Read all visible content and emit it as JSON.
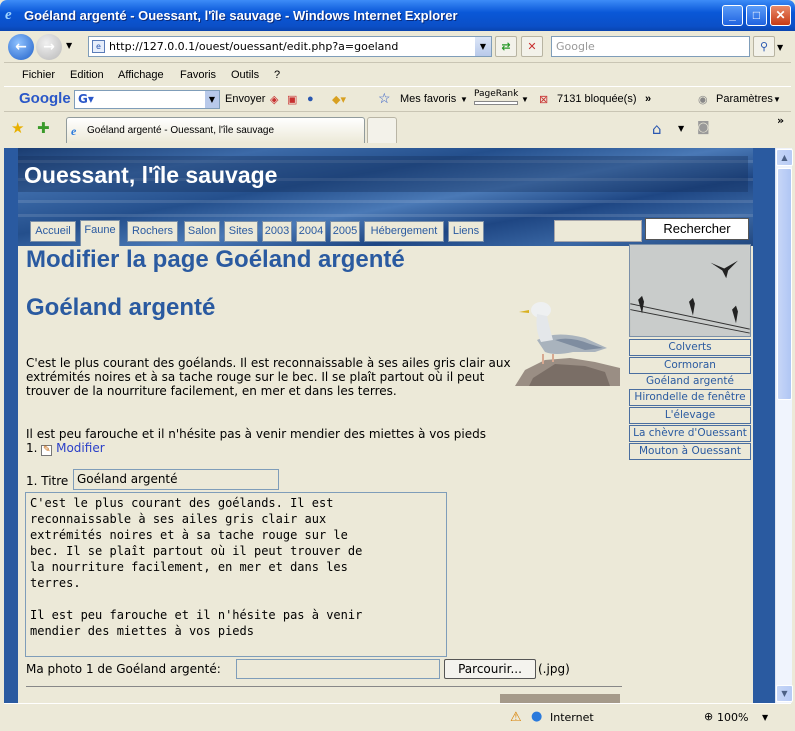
{
  "window": {
    "title": "Goéland argenté - Ouessant, l'île sauvage - Windows Internet Explorer"
  },
  "address": {
    "url": "http://127.0.0.1/ouest/ouessant/edit.php?a=goeland",
    "search_placeholder": "Google"
  },
  "menu": [
    "Fichier",
    "Edition",
    "Affichage",
    "Favoris",
    "Outils",
    "?"
  ],
  "googlebar": {
    "logo": "Google",
    "send": "Envoyer",
    "favorites": "Mes favoris",
    "pagerank": "PageRank",
    "blocked": "7131 bloquée(s)",
    "settings": "Paramètres"
  },
  "tab": {
    "title": "Goéland argenté - Ouessant, l'île sauvage"
  },
  "site": {
    "title": "Ouessant, l'île sauvage",
    "nav": [
      "Accueil",
      "Faune",
      "Rochers",
      "Salon",
      "Sites",
      "2003",
      "2004",
      "2005",
      "Hébergement",
      "Liens"
    ],
    "search_button": "Rechercher"
  },
  "main": {
    "heading": "Modifier la page Goéland argenté",
    "subheading": "Goéland argenté",
    "para1": "C'est le plus courant des goélands. Il est reconnaissable à ses ailes gris clair aux extrémités noires et à sa tache rouge sur le bec. Il se plaît partout où il peut trouver de la nourriture facilement, en mer et dans les terres.",
    "para2": "Il est peu farouche et il n'hésite pas à venir mendier des miettes à vos pieds",
    "item_num": "1.",
    "modify_link": "Modifier"
  },
  "form": {
    "titre_label": "1. Titre",
    "titre_value": "Goéland argenté",
    "text_value": "C'est le plus courant des goélands. Il est\nreconnaissable à ses ailes gris clair aux\nextrémités noires et à sa tache rouge sur le\nbec. Il se plaît partout où il peut trouver de\nla nourriture facilement, en mer et dans les\nterres.\n\nIl est peu farouche et il n'hésite pas à venir\nmendier des miettes à vos pieds",
    "photo_label": "Ma photo 1 de Goéland argenté:",
    "browse": "Parcourir...",
    "ext": "(.jpg)"
  },
  "sidebar": {
    "links": [
      "Colverts",
      "Cormoran",
      "Goéland argenté",
      "Hirondelle de fenêtre",
      "L'élevage",
      "La chèvre d'Ouessant",
      "Mouton à Ouessant"
    ],
    "current": "Goéland argenté"
  },
  "status": {
    "zone": "Internet",
    "zoom": "100%"
  }
}
